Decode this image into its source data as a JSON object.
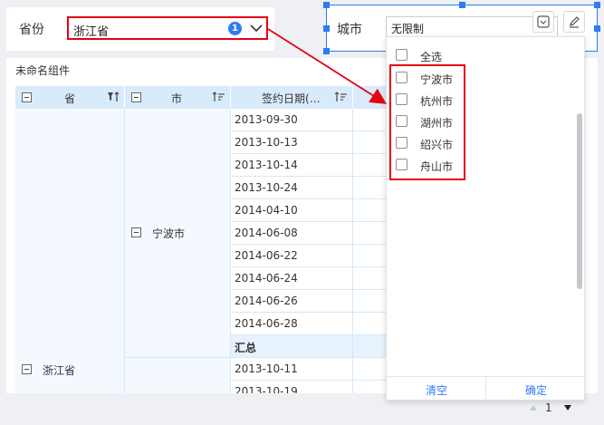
{
  "province_filter": {
    "label": "省份",
    "value": "浙江省",
    "selected_count": "1",
    "chevron_icon": "chevron-down-icon"
  },
  "city_filter": {
    "label": "城市",
    "value": "无限制",
    "tools": [
      "collapse-icon",
      "edit-icon"
    ]
  },
  "table": {
    "title": "未命名组件",
    "headers": {
      "province": "省",
      "city": "市",
      "sign_date": "签约日期(…"
    },
    "province_value": "浙江省",
    "city_value": "宁波市",
    "dates": [
      "2013-09-30",
      "2013-10-13",
      "2013-10-14",
      "2013-10-24",
      "2014-04-10",
      "2014-06-08",
      "2014-06-22",
      "2014-06-24",
      "2014-06-26",
      "2014-06-28"
    ],
    "subtotal_label": "汇总",
    "next_dates": [
      "2013-10-11",
      "2013-10-19"
    ]
  },
  "dropdown": {
    "select_all": "全选",
    "options": [
      "宁波市",
      "杭州市",
      "湖州市",
      "绍兴市",
      "舟山市"
    ],
    "clear_label": "清空",
    "confirm_label": "确定"
  },
  "pager": {
    "page": "1"
  },
  "colors": {
    "accent": "#2f7bf2",
    "highlight": "#e60012",
    "header_bg": "#d9ebfa"
  }
}
